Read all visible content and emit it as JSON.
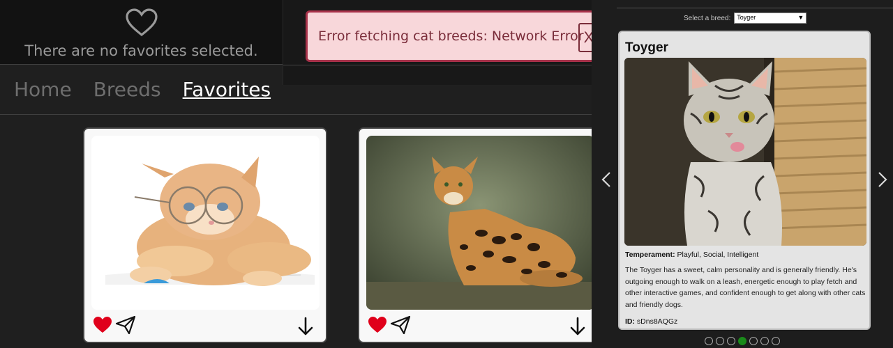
{
  "favorites": {
    "empty_text": "There are no favorites selected.",
    "icon": "heart-outline-icon"
  },
  "error": {
    "message": "Error fetching cat breeds: Network Error",
    "close_label": "X",
    "background": "#f8d7da",
    "border": "#a8324a"
  },
  "nav": {
    "items": [
      {
        "label": "Home"
      },
      {
        "label": "Breeds"
      },
      {
        "label": "Favorites"
      }
    ],
    "active": "Favorites"
  },
  "cards": [
    {
      "image": "kitten-with-glasses",
      "icons": [
        "heart-filled-icon",
        "send-icon",
        "download-icon"
      ]
    },
    {
      "image": "bengal-cat-sitting",
      "icons": [
        "heart-filled-icon",
        "send-icon",
        "download-icon"
      ]
    }
  ],
  "breed_panel": {
    "select_label": "Select a breed:",
    "selected_breed": "Toyger",
    "name": "Toyger",
    "temperament_label": "Temperament:",
    "temperament": "Playful, Social, Intelligent",
    "description": "The Toyger has a sweet, calm personality and is generally friendly. He's outgoing enough to walk on a leash, energetic enough to play fetch and other interactive games, and confident enough to get along with other cats and friendly dogs.",
    "id_label": "ID:",
    "id": "sDns8AQGz",
    "carousel_dots": 7,
    "active_dot": 4
  },
  "colors": {
    "accent_active_dot": "#1a8a1a",
    "heart": "#e0001b"
  }
}
